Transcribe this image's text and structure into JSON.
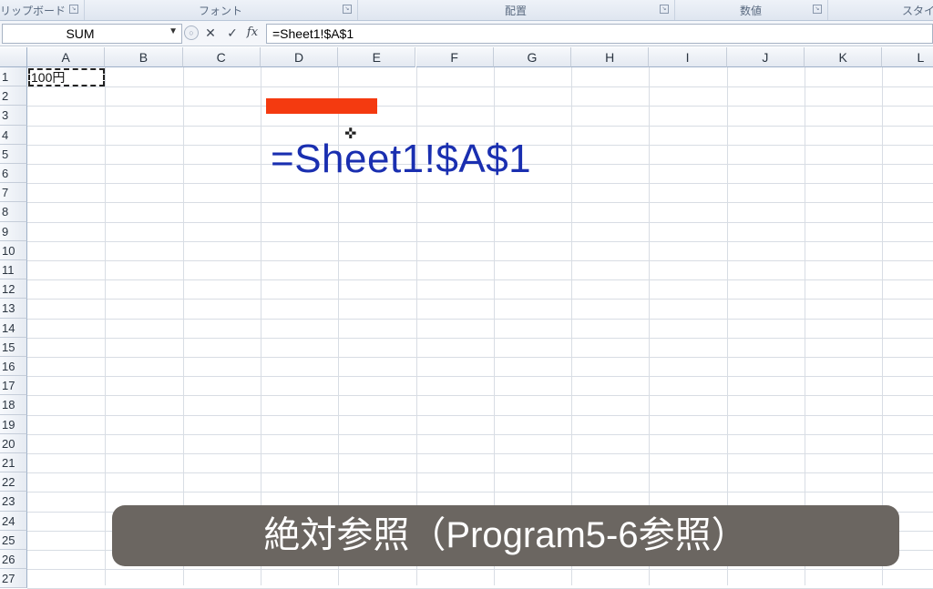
{
  "ribbon": {
    "groups": [
      {
        "label": "クリップボード"
      },
      {
        "label": "フォント"
      },
      {
        "label": "配置"
      },
      {
        "label": "数値"
      },
      {
        "label": "スタイル"
      }
    ]
  },
  "formula_bar": {
    "name_box": "SUM",
    "cancel_symbol": "✕",
    "enter_symbol": "✓",
    "fx_symbol": "fx",
    "content": "=Sheet1!$A$1"
  },
  "sheet": {
    "columns": [
      "A",
      "B",
      "C",
      "D",
      "E",
      "F",
      "G",
      "H",
      "I",
      "J",
      "K",
      "L"
    ],
    "rows": [
      "1",
      "2",
      "3",
      "4",
      "5",
      "6",
      "7",
      "8",
      "9",
      "10",
      "11",
      "12",
      "13",
      "14",
      "15",
      "16",
      "17",
      "18",
      "19",
      "20",
      "21",
      "22",
      "23",
      "24",
      "25",
      "26",
      "27"
    ],
    "cell_A1": "100円",
    "overlay_formula": "=Sheet1!$A$1"
  },
  "caption": "絶対参照（Program5-6参照）",
  "colors": {
    "formula_text": "#1a2fb0",
    "highlight_bar": "#f43a10",
    "caption_bg": "#6b6661"
  }
}
